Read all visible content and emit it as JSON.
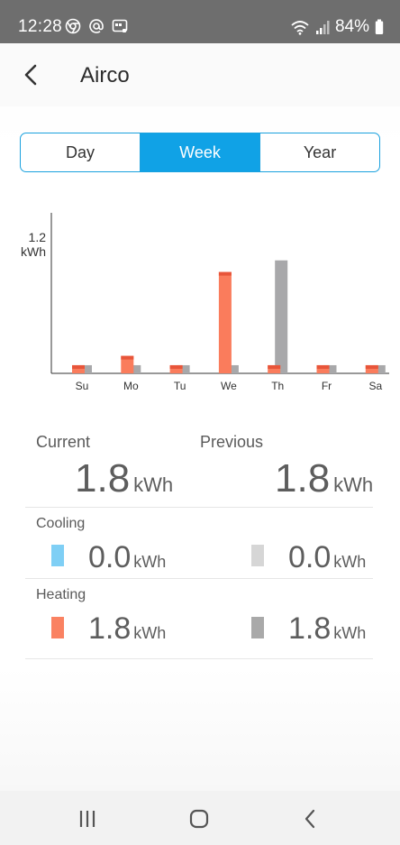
{
  "status_bar": {
    "time": "12:28",
    "battery": "84%",
    "icons": [
      "chrome-icon",
      "at-sign-icon",
      "app-notification-icon",
      "wifi-icon",
      "signal-icon",
      "battery-icon"
    ]
  },
  "header": {
    "title": "Airco",
    "back_icon": "chevron-left-icon"
  },
  "period_tabs": {
    "items": [
      {
        "label": "Day",
        "active": false
      },
      {
        "label": "Week",
        "active": true
      },
      {
        "label": "Year",
        "active": false
      }
    ],
    "accent": "#10a2e6"
  },
  "chart_data": {
    "type": "bar",
    "ytick_label_value": "1.2",
    "ytick_label_unit": "kWh",
    "ylim": [
      0,
      1.2
    ],
    "categories": [
      "Su",
      "Mo",
      "Tu",
      "We",
      "Th",
      "Fr",
      "Sa"
    ],
    "series": [
      {
        "color": "#fa7c5c",
        "cap_color": "#e8553a",
        "values": [
          0.07,
          0.15,
          0.07,
          0.87,
          0.07,
          0.07,
          0.07
        ]
      },
      {
        "color": "#a8a8aa",
        "values": [
          0.07,
          0.07,
          0.07,
          0.07,
          0.97,
          0.07,
          0.07
        ]
      }
    ],
    "grid": false
  },
  "summary": {
    "current_label": "Current",
    "previous_label": "Previous",
    "current_value": "1.8",
    "previous_value": "1.8",
    "unit": "kWh",
    "cooling": {
      "label": "Cooling",
      "current": "0.0",
      "previous": "0.0",
      "current_color": "#7fcff5",
      "previous_color": "#d6d6d6"
    },
    "heating": {
      "label": "Heating",
      "current": "1.8",
      "previous": "1.8",
      "current_color": "#fa8262",
      "previous_color": "#a9a9a9"
    }
  },
  "nav_bar": {
    "icons": [
      "recent-apps-icon",
      "home-icon",
      "back-icon"
    ]
  }
}
